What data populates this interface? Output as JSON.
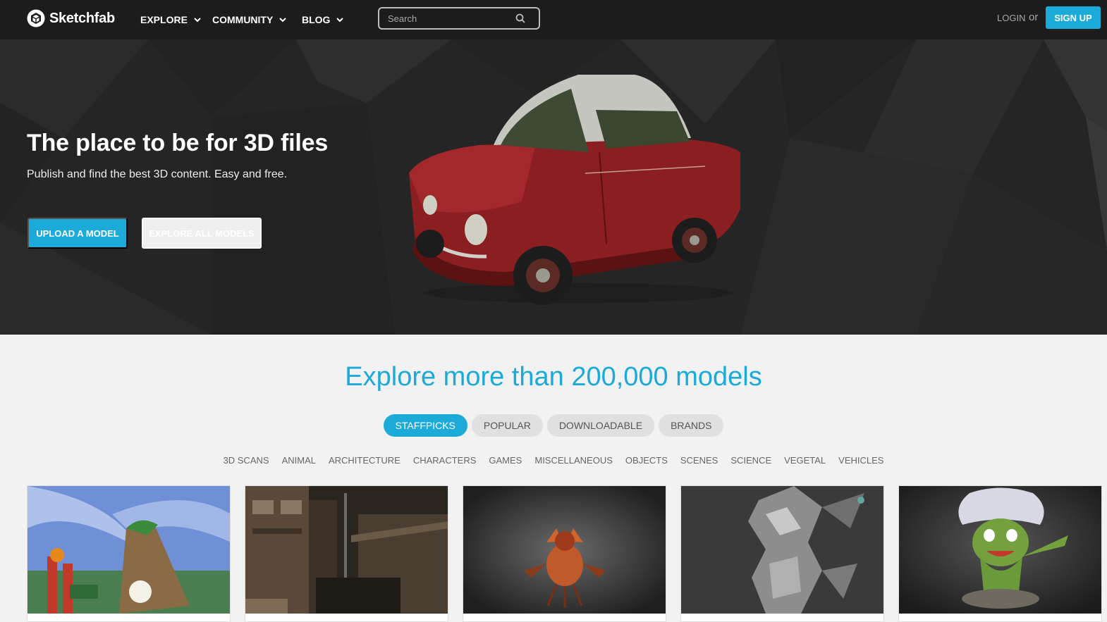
{
  "header": {
    "brand": "Sketchfab",
    "nav": [
      {
        "label": "EXPLORE"
      },
      {
        "label": "COMMUNITY"
      },
      {
        "label": "BLOG"
      }
    ],
    "search_placeholder": "Search",
    "login_label": "LOGIN",
    "or_label": "or",
    "signup_label": "SIGN UP"
  },
  "hero": {
    "title": "The place to be for 3D files",
    "subtitle": "Publish and find the best 3D content. Easy and free.",
    "upload_label": "UPLOAD A MODEL",
    "explore_label": "EXPLORE ALL MODELS"
  },
  "explore": {
    "title": "Explore more than 200,000 models",
    "tabs": [
      {
        "label": "STAFFPICKS",
        "active": true
      },
      {
        "label": "POPULAR"
      },
      {
        "label": "DOWNLOADABLE"
      },
      {
        "label": "BRANDS"
      }
    ],
    "categories": [
      "3D SCANS",
      "ANIMAL",
      "ARCHITECTURE",
      "CHARACTERS",
      "GAMES",
      "MISCELLANEOUS",
      "OBJECTS",
      "SCENES",
      "SCIENCE",
      "VEGETAL",
      "VEHICLES"
    ]
  },
  "colors": {
    "accent": "#1caad9",
    "header_bg": "#1c1c1c",
    "hero_bg": "#252525",
    "page_bg": "#f2f2f2"
  },
  "icons": {
    "logo": "sketchfab-cube-icon",
    "chevron": "chevron-down-icon",
    "search": "search-icon"
  }
}
